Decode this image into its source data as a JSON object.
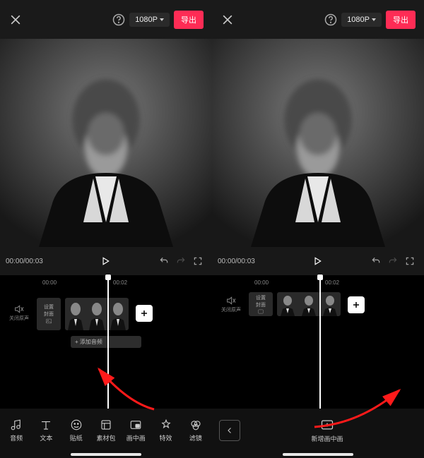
{
  "topbar": {
    "resolution": "1080P",
    "export": "导出"
  },
  "transport": {
    "time": "00:00/00:03"
  },
  "ruler": {
    "t0": "00:00",
    "t1": "00:02"
  },
  "mute_label": "关闭原声",
  "cover_label_1": "设置",
  "cover_label_2": "封面",
  "add_audio": "+ 添加音频",
  "tools": {
    "audio": "音频",
    "text": "文本",
    "sticker": "贴纸",
    "material": "素材包",
    "pip": "画中画",
    "effect": "特效",
    "filter": "滤镜"
  },
  "pip_new": "新增画中画"
}
